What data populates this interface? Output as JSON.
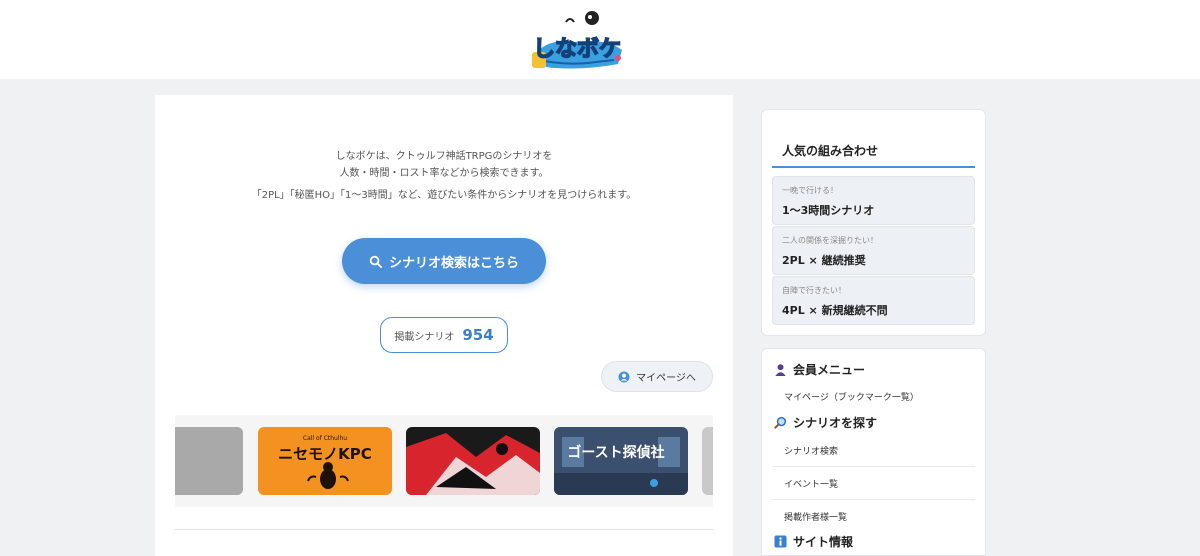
{
  "logo": {
    "text": "しなボケ"
  },
  "intro": {
    "line1": "しなボケは、クトゥルフ神話TRPGのシナリオを",
    "line2": "人数・時間・ロスト率などから検索できます。",
    "line3": "「2PL」「秘匿HO」「1〜3時間」など、遊びたい条件からシナリオを見つけられます。"
  },
  "search_button": {
    "label": "シナリオ検索はこちら",
    "icon": "search-icon"
  },
  "count": {
    "label": "掲載シナリオ",
    "value": "954"
  },
  "mypage_button": {
    "label": "マイページへ",
    "icon": "user-icon"
  },
  "carousel": {
    "cards": [
      {
        "caption": ""
      },
      {
        "caption": "ニセモノKPC",
        "subcaption": "Call of Cthulhu"
      },
      {
        "caption": ""
      },
      {
        "caption": "ゴースト探偵社"
      },
      {
        "caption": ""
      }
    ]
  },
  "popular": {
    "title": "人気の組み合わせ",
    "items": [
      {
        "sub": "一晩で行ける！",
        "main": "1〜3時間シナリオ"
      },
      {
        "sub": "二人の関係を深掘りたい！",
        "main": "2PL × 継続推奨"
      },
      {
        "sub": "自陣で行きたい！",
        "main": "4PL × 新規継続不問"
      }
    ]
  },
  "menu": {
    "member": {
      "title": "会員メニュー",
      "icon": "member-icon",
      "items": [
        "マイページ（ブックマーク一覧）"
      ]
    },
    "search": {
      "title": "シナリオを探す",
      "icon": "magnifier-icon",
      "items": [
        "シナリオ検索",
        "イベント一覧",
        "掲載作者様一覧"
      ]
    },
    "info": {
      "title": "サイト情報",
      "icon": "info-icon"
    }
  },
  "colors": {
    "accent": "#4a8fd8",
    "background": "#f0f1f3",
    "card_orange": "#f39220",
    "card_red": "#d8242c"
  }
}
